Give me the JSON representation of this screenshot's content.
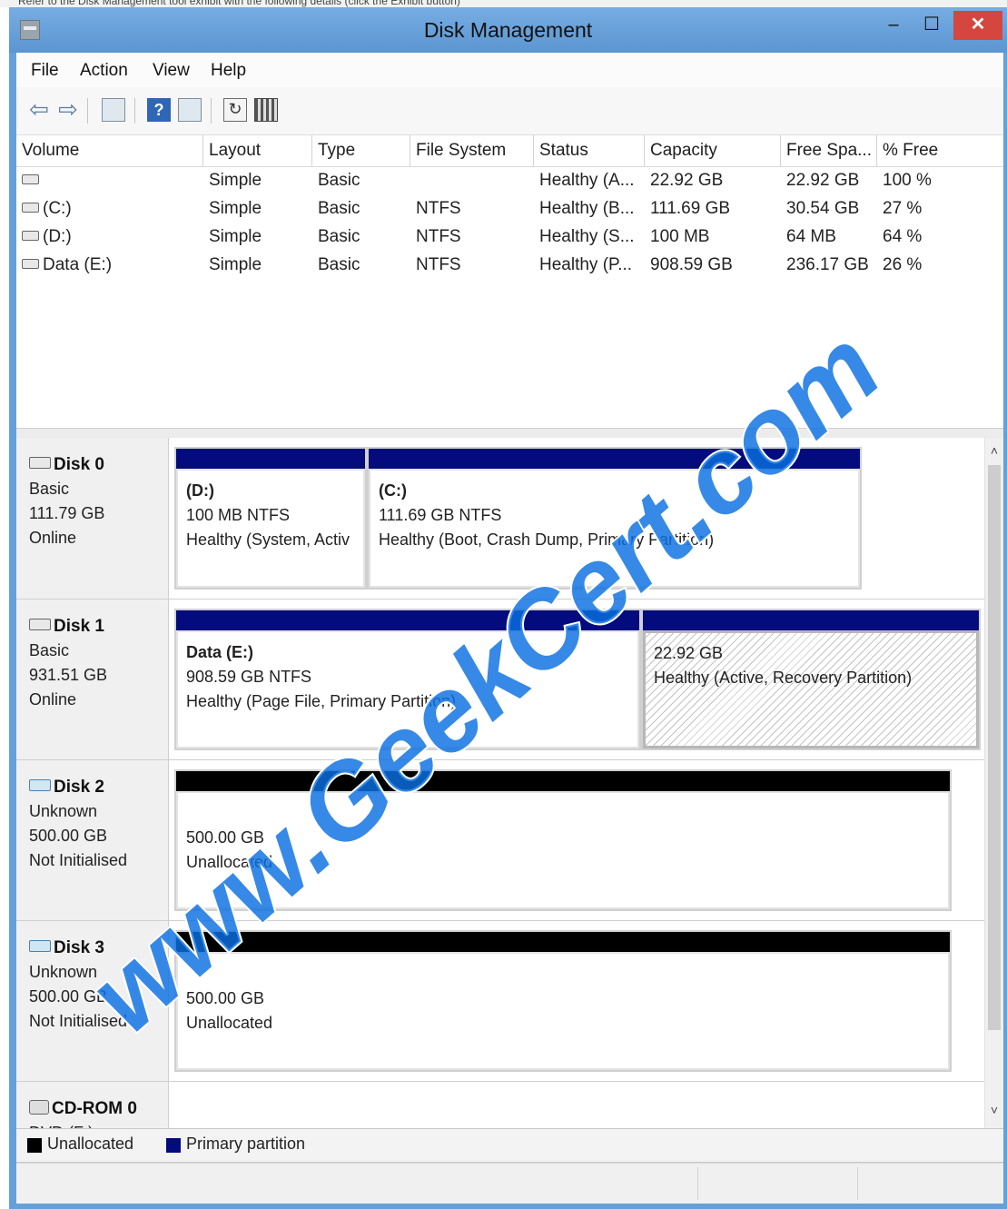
{
  "top_caption": "Refer to the Disk Management tool exhibit with the following details (click the Exhibit button)",
  "window": {
    "title": "Disk Management"
  },
  "menu": [
    "File",
    "Action",
    "View",
    "Help"
  ],
  "volume_table": {
    "columns": [
      "Volume",
      "Layout",
      "Type",
      "File System",
      "Status",
      "Capacity",
      "Free Spa...",
      "% Free"
    ],
    "rows": [
      [
        "",
        "Simple",
        "Basic",
        "",
        "Healthy (A...",
        "22.92 GB",
        "22.92 GB",
        "100 %"
      ],
      [
        "(C:)",
        "Simple",
        "Basic",
        "NTFS",
        "Healthy (B...",
        "111.69 GB",
        "30.54 GB",
        "27 %"
      ],
      [
        "(D:)",
        "Simple",
        "Basic",
        "NTFS",
        "Healthy (S...",
        "100 MB",
        "64 MB",
        "64 %"
      ],
      [
        "Data (E:)",
        "Simple",
        "Basic",
        "NTFS",
        "Healthy (P...",
        "908.59 GB",
        "236.17 GB",
        "26 %"
      ]
    ]
  },
  "disks": [
    {
      "name": "Disk 0",
      "type": "Basic",
      "size": "111.79 GB",
      "state": "Online",
      "partitions": [
        {
          "name": "(D:)",
          "size": "100 MB NTFS",
          "status": "Healthy (System, Activ",
          "style": "primary"
        },
        {
          "name": "(C:)",
          "size": "111.69 GB NTFS",
          "status": "Healthy (Boot, Crash Dump, Primary Partition)",
          "style": "primary"
        }
      ]
    },
    {
      "name": "Disk 1",
      "type": "Basic",
      "size": "931.51 GB",
      "state": "Online",
      "partitions": [
        {
          "name": "Data  (E:)",
          "size": "908.59 GB NTFS",
          "status": "Healthy (Page File, Primary Partition)",
          "style": "primary"
        },
        {
          "name": "",
          "size": "22.92 GB",
          "status": "Healthy (Active, Recovery Partition)",
          "style": "primary-hatched"
        }
      ]
    },
    {
      "name": "Disk 2",
      "type": "Unknown",
      "size": "500.00 GB",
      "state": "Not Initialised",
      "partitions": [
        {
          "size": "500.00 GB",
          "status": "Unallocated",
          "style": "unallocated"
        }
      ]
    },
    {
      "name": "Disk 3",
      "type": "Unknown",
      "size": "500.00 GB",
      "state": "Not Initialised",
      "partitions": [
        {
          "size": "500.00 GB",
          "status": "Unallocated",
          "style": "unallocated"
        }
      ]
    },
    {
      "name": "CD-ROM 0",
      "type": "DVD (F:)"
    }
  ],
  "legend": {
    "unallocated": "Unallocated",
    "primary": "Primary partition"
  },
  "watermark": "www.GeekCert.com",
  "colors": {
    "primary_bar": "#030b7d",
    "unallocated_bar": "#000000",
    "title_bar": "#67a0d8",
    "close_button": "#d4463e",
    "watermark": "#0a6fe0"
  }
}
